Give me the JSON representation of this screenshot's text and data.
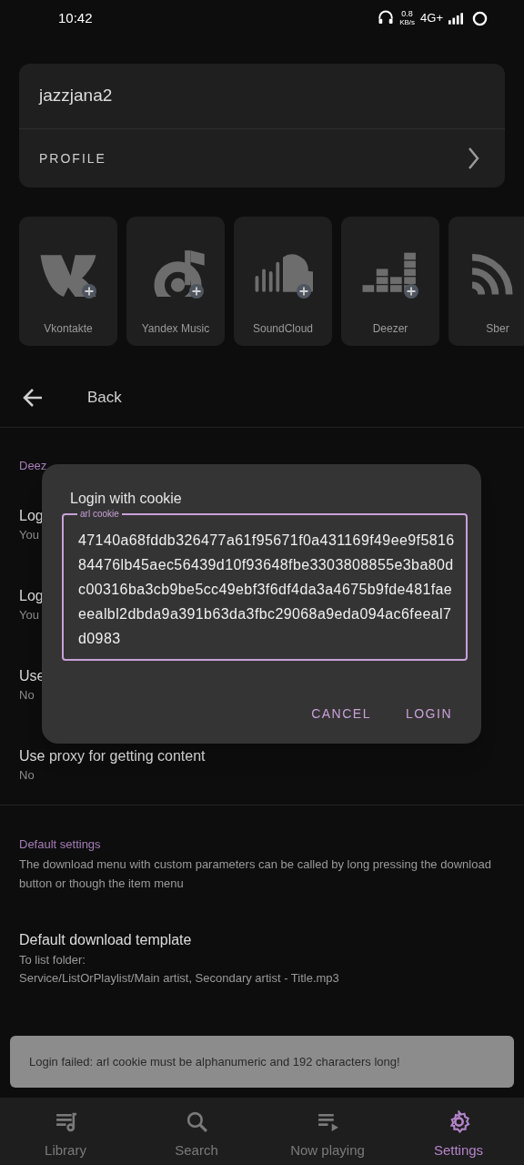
{
  "status_bar": {
    "time": "10:42",
    "speed_value": "0.8",
    "speed_unit": "KB/s",
    "network": "4G+"
  },
  "profile": {
    "username": "jazzjana2",
    "link": "PROFILE"
  },
  "services": [
    {
      "label": "Vkontakte"
    },
    {
      "label": "Yandex Music"
    },
    {
      "label": "SoundCloud"
    },
    {
      "label": "Deezer"
    },
    {
      "label": "Sber"
    }
  ],
  "back": {
    "label": "Back"
  },
  "settings": {
    "section": "Deez",
    "items": [
      {
        "title": "Log",
        "value": "You"
      },
      {
        "title": "Log",
        "value": "You"
      },
      {
        "title": "Use",
        "value": "No"
      },
      {
        "title": "Use proxy for getting content",
        "value": "No"
      }
    ]
  },
  "default_settings": {
    "section": "Default settings",
    "description": "The download menu with custom parameters can be called by long pressing the download button or though the item menu",
    "items": [
      {
        "title": "Default download template",
        "lines": [
          "To list folder:",
          "Service/ListOrPlaylist/Main artist, Secondary artist - Title.mp3"
        ]
      }
    ]
  },
  "dialog": {
    "title": "Login with cookie",
    "field_label": "arl cookie",
    "field_value": "47140a68fddb326477a61f95671f0a431169f49ee9f581684476lb45aec56439d10f93648fbe3303808855e3ba80dc00316ba3cb9be5cc49ebf3f6df4da3a4675b9fde481faeeealbl2dbda9a391b63da3fbc29068a9eda094ac6feeal7d0983",
    "buttons": [
      "CANCEL",
      "LOGIN"
    ]
  },
  "toast": "Login failed: arl cookie must be alphanumeric and 192 characters long!",
  "nav": [
    {
      "label": "Library",
      "selected": false
    },
    {
      "label": "Search",
      "selected": false
    },
    {
      "label": "Now playing",
      "selected": false
    },
    {
      "label": "Settings",
      "selected": true
    }
  ]
}
